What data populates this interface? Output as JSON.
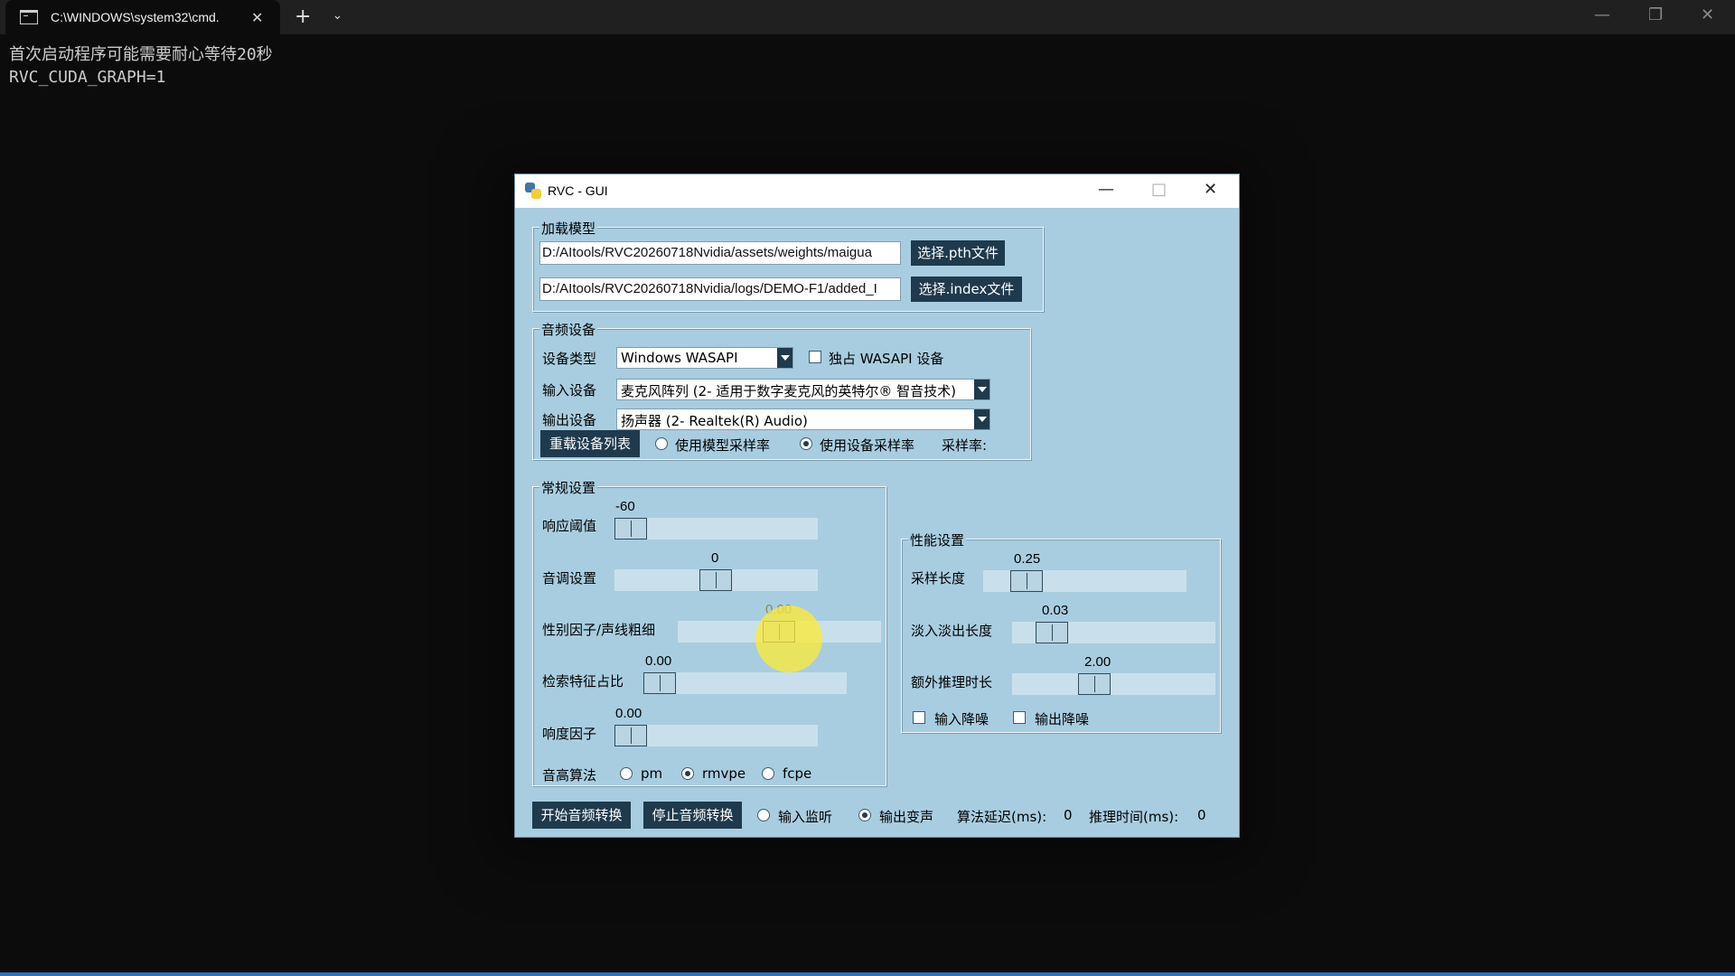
{
  "terminal": {
    "tab_title": "C:\\WINDOWS\\system32\\cmd.",
    "close_glyph": "✕",
    "new_tab_glyph": "+",
    "dropdown_glyph": "⌄",
    "minimize_glyph": "—",
    "maximize_glyph": "❐",
    "close_window_glyph": "✕",
    "lines": [
      "首次启动程序可能需要耐心等待20秒",
      "RVC_CUDA_GRAPH=1"
    ]
  },
  "window": {
    "title": "RVC - GUI",
    "minimize_glyph": "—",
    "maximize_glyph": "□",
    "close_glyph": "✕"
  },
  "load_model": {
    "label": "加载模型",
    "pth_path": "D:/AItools/RVC20260718Nvidia/assets/weights/maigua",
    "pth_button": "选择.pth文件",
    "index_path": "D:/AItools/RVC20260718Nvidia/logs/DEMO-F1/added_I",
    "index_button": "选择.index文件"
  },
  "audio_device": {
    "label": "音频设备",
    "device_type_label": "设备类型",
    "device_type_value": "Windows WASAPI",
    "exclusive_label": "独占 WASAPI 设备",
    "input_label": "输入设备",
    "input_value": "麦克风阵列 (2- 适用于数字麦克风的英特尔® 智音技术)",
    "output_label": "输出设备",
    "output_value": "扬声器 (2- Realtek(R) Audio)",
    "reload_button": "重载设备列表",
    "use_model_sr": "使用模型采样率",
    "use_device_sr": "使用设备采样率",
    "sample_rate_label": "采样率:"
  },
  "general": {
    "label": "常规设置",
    "threshold_label": "响应阈值",
    "threshold_value": "-60",
    "pitch_label": "音调设置",
    "pitch_value": "0",
    "formant_label": "性别因子/声线粗细",
    "formant_value": "0.00",
    "index_rate_label": "检索特征占比",
    "index_rate_value": "0.00",
    "rms_label": "响度因子",
    "rms_value": "0.00",
    "f0_label": "音高算法",
    "f0_options": [
      "pm",
      "rmvpe",
      "fcpe"
    ]
  },
  "performance": {
    "label": "性能设置",
    "block_label": "采样长度",
    "block_value": "0.25",
    "crossfade_label": "淡入淡出长度",
    "crossfade_value": "0.03",
    "extra_label": "额外推理时长",
    "extra_value": "2.00",
    "input_denoise": "输入降噪",
    "output_denoise": "输出降噪"
  },
  "bottom": {
    "start_button": "开始音频转换",
    "stop_button": "停止音频转换",
    "input_monitor": "输入监听",
    "output_voice": "输出变声",
    "delay_label": "算法延迟(ms):",
    "delay_value": "0",
    "infer_label": "推理时间(ms):",
    "infer_value": "0"
  }
}
